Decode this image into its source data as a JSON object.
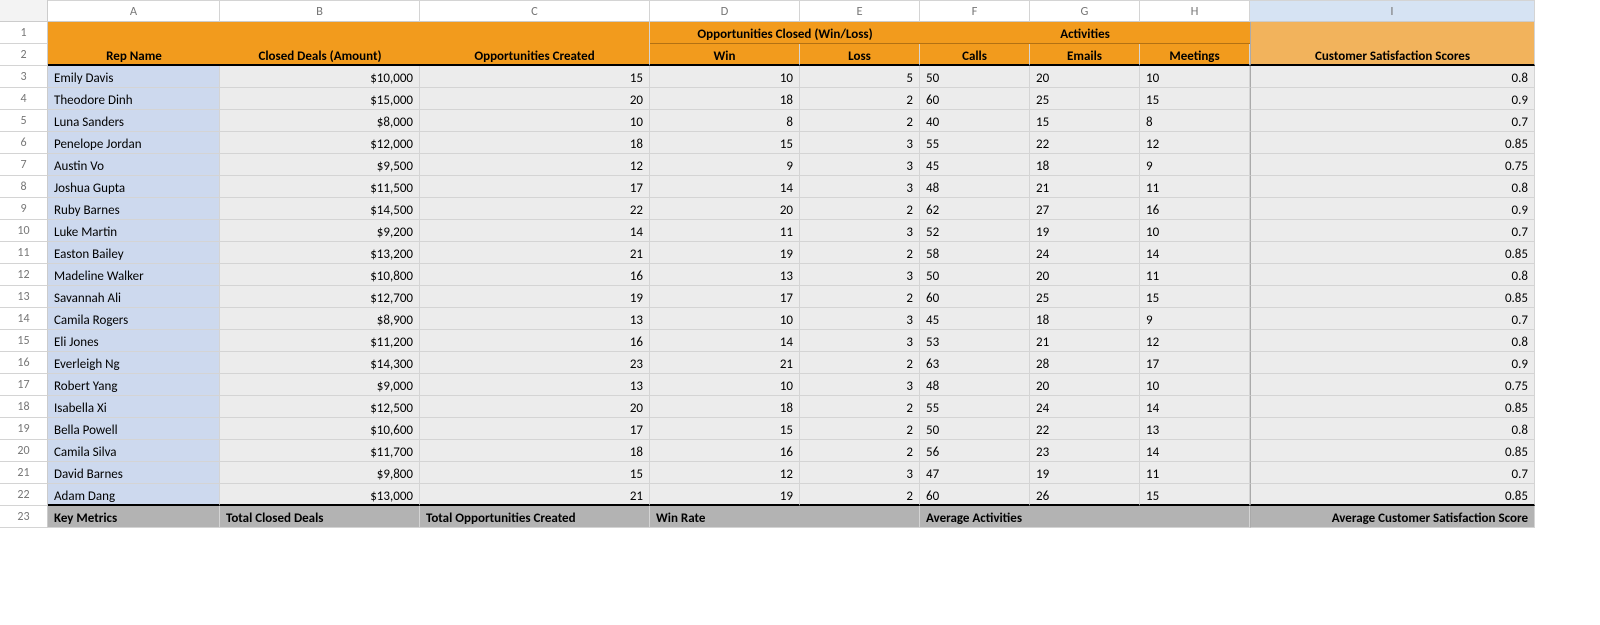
{
  "cols": [
    "A",
    "B",
    "C",
    "D",
    "E",
    "F",
    "G",
    "H",
    "I"
  ],
  "top": {
    "rep": "Rep Name",
    "closed": "Closed Deals (Amount)",
    "opps": "Opportunities Created",
    "oc": "Opportunities Closed (Win/Loss)",
    "act": "Activities",
    "css": "Customer Satisfaction Scores",
    "win": "Win",
    "loss": "Loss",
    "calls": "Calls",
    "emails": "Emails",
    "meet": "Meetings"
  },
  "rows": [
    {
      "name": "Emily Davis",
      "amt": "$10,000",
      "opp": "15",
      "win": "10",
      "loss": "5",
      "calls": "50",
      "emails": "20",
      "meet": "10",
      "css": "0.8"
    },
    {
      "name": "Theodore Dinh",
      "amt": "$15,000",
      "opp": "20",
      "win": "18",
      "loss": "2",
      "calls": "60",
      "emails": "25",
      "meet": "15",
      "css": "0.9"
    },
    {
      "name": "Luna Sanders",
      "amt": "$8,000",
      "opp": "10",
      "win": "8",
      "loss": "2",
      "calls": "40",
      "emails": "15",
      "meet": "8",
      "css": "0.7"
    },
    {
      "name": "Penelope Jordan",
      "amt": "$12,000",
      "opp": "18",
      "win": "15",
      "loss": "3",
      "calls": "55",
      "emails": "22",
      "meet": "12",
      "css": "0.85"
    },
    {
      "name": "Austin Vo",
      "amt": "$9,500",
      "opp": "12",
      "win": "9",
      "loss": "3",
      "calls": "45",
      "emails": "18",
      "meet": "9",
      "css": "0.75"
    },
    {
      "name": "Joshua Gupta",
      "amt": "$11,500",
      "opp": "17",
      "win": "14",
      "loss": "3",
      "calls": "48",
      "emails": "21",
      "meet": "11",
      "css": "0.8"
    },
    {
      "name": "Ruby Barnes",
      "amt": "$14,500",
      "opp": "22",
      "win": "20",
      "loss": "2",
      "calls": "62",
      "emails": "27",
      "meet": "16",
      "css": "0.9"
    },
    {
      "name": "Luke Martin",
      "amt": "$9,200",
      "opp": "14",
      "win": "11",
      "loss": "3",
      "calls": "52",
      "emails": "19",
      "meet": "10",
      "css": "0.7"
    },
    {
      "name": "Easton Bailey",
      "amt": "$13,200",
      "opp": "21",
      "win": "19",
      "loss": "2",
      "calls": "58",
      "emails": "24",
      "meet": "14",
      "css": "0.85"
    },
    {
      "name": "Madeline Walker",
      "amt": "$10,800",
      "opp": "16",
      "win": "13",
      "loss": "3",
      "calls": "50",
      "emails": "20",
      "meet": "11",
      "css": "0.8"
    },
    {
      "name": "Savannah Ali",
      "amt": "$12,700",
      "opp": "19",
      "win": "17",
      "loss": "2",
      "calls": "60",
      "emails": "25",
      "meet": "15",
      "css": "0.85"
    },
    {
      "name": "Camila Rogers",
      "amt": "$8,900",
      "opp": "13",
      "win": "10",
      "loss": "3",
      "calls": "45",
      "emails": "18",
      "meet": "9",
      "css": "0.7"
    },
    {
      "name": "Eli Jones",
      "amt": "$11,200",
      "opp": "16",
      "win": "14",
      "loss": "3",
      "calls": "53",
      "emails": "21",
      "meet": "12",
      "css": "0.8"
    },
    {
      "name": "Everleigh Ng",
      "amt": "$14,300",
      "opp": "23",
      "win": "21",
      "loss": "2",
      "calls": "63",
      "emails": "28",
      "meet": "17",
      "css": "0.9"
    },
    {
      "name": "Robert Yang",
      "amt": "$9,000",
      "opp": "13",
      "win": "10",
      "loss": "3",
      "calls": "48",
      "emails": "20",
      "meet": "10",
      "css": "0.75"
    },
    {
      "name": "Isabella Xi",
      "amt": "$12,500",
      "opp": "20",
      "win": "18",
      "loss": "2",
      "calls": "55",
      "emails": "24",
      "meet": "14",
      "css": "0.85"
    },
    {
      "name": "Bella Powell",
      "amt": "$10,600",
      "opp": "17",
      "win": "15",
      "loss": "2",
      "calls": "50",
      "emails": "22",
      "meet": "13",
      "css": "0.8"
    },
    {
      "name": "Camila Silva",
      "amt": "$11,700",
      "opp": "18",
      "win": "16",
      "loss": "2",
      "calls": "56",
      "emails": "23",
      "meet": "14",
      "css": "0.85"
    },
    {
      "name": "David Barnes",
      "amt": "$9,800",
      "opp": "15",
      "win": "12",
      "loss": "3",
      "calls": "47",
      "emails": "19",
      "meet": "11",
      "css": "0.7"
    },
    {
      "name": "Adam Dang",
      "amt": "$13,000",
      "opp": "21",
      "win": "19",
      "loss": "2",
      "calls": "60",
      "emails": "26",
      "meet": "15",
      "css": "0.85"
    }
  ],
  "km": {
    "label": "Key Metrics",
    "tcd": "Total Closed Deals",
    "toc": "Total Opportunities Created",
    "wr": "Win Rate",
    "aa": "Average Activities",
    "acss": "Average Customer Satisfaction Score"
  }
}
